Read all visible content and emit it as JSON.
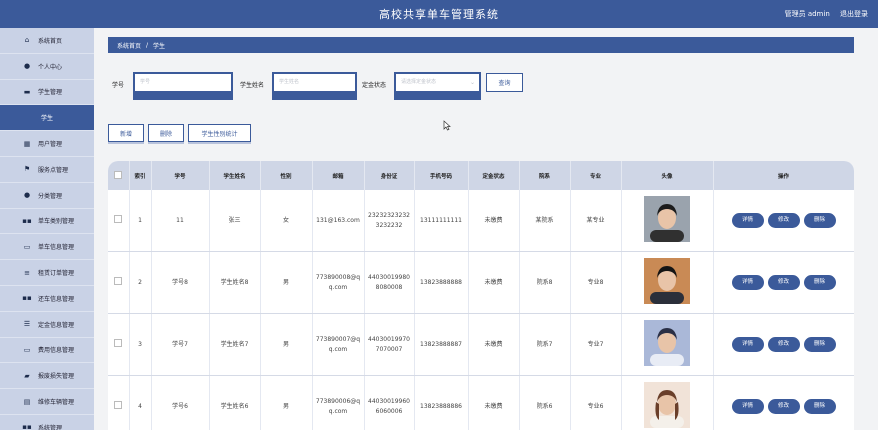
{
  "header": {
    "title": "高校共享单车管理系统",
    "user_label": "管理员 admin",
    "logout": "退出登录"
  },
  "sidebar": {
    "items": [
      {
        "label": "系统首页",
        "icon": "home-icon"
      },
      {
        "label": "个人中心",
        "icon": "user-icon"
      },
      {
        "label": "学生管理",
        "icon": "folder-icon"
      },
      {
        "label": "学生",
        "icon": "",
        "active": true
      },
      {
        "label": "用户管理",
        "icon": "grid-icon"
      },
      {
        "label": "服务点管理",
        "icon": "flag-icon"
      },
      {
        "label": "分类管理",
        "icon": "pin-icon"
      },
      {
        "label": "单车类别管理",
        "icon": "apps-icon"
      },
      {
        "label": "单车信息管理",
        "icon": "card-icon"
      },
      {
        "label": "租赁订单管理",
        "icon": "sliders-icon"
      },
      {
        "label": "还车信息管理",
        "icon": "apps-icon"
      },
      {
        "label": "定金信息管理",
        "icon": "list-icon"
      },
      {
        "label": "费用信息管理",
        "icon": "card-icon"
      },
      {
        "label": "报废损失管理",
        "icon": "car-icon"
      },
      {
        "label": "维修车辆管理",
        "icon": "document-icon"
      },
      {
        "label": "系统管理",
        "icon": "apps-icon"
      }
    ]
  },
  "breadcrumb": {
    "home": "系统首页",
    "sep": "/",
    "current": "学生"
  },
  "search": {
    "student_no_label": "学号",
    "student_no_placeholder": "学号",
    "name_label": "学生姓名",
    "name_placeholder": "学生姓名",
    "deposit_label": "定金状态",
    "deposit_placeholder": "请选择定金状态",
    "query_button": "查询"
  },
  "actions": {
    "add": "新增",
    "delete": "删除",
    "gender_stats": "学生性别统计"
  },
  "table": {
    "headers": [
      "",
      "索引",
      "学号",
      "学生姓名",
      "性别",
      "邮箱",
      "身份证",
      "手机号码",
      "定金状态",
      "院系",
      "专业",
      "头像",
      "操作"
    ],
    "op_labels": [
      "详情",
      "修改",
      "删除"
    ],
    "rows": [
      {
        "index": "1",
        "student_no": "11",
        "name": "张三",
        "gender": "女",
        "email": "131@163.com",
        "id_card": "232323232323232232",
        "phone": "13111111111",
        "deposit": "未缴费",
        "dept": "某院系",
        "major": "某专业",
        "avatar": "avatar-man-dark"
      },
      {
        "index": "2",
        "student_no": "学号8",
        "name": "学生姓名8",
        "gender": "男",
        "email": "773890008@qq.com",
        "id_card": "440300199808080008",
        "phone": "13823888888",
        "deposit": "未缴费",
        "dept": "院系8",
        "major": "专业8",
        "avatar": "avatar-man-dusk"
      },
      {
        "index": "3",
        "student_no": "学号7",
        "name": "学生姓名7",
        "gender": "男",
        "email": "773890007@qq.com",
        "id_card": "440300199707070007",
        "phone": "13823888887",
        "deposit": "未缴费",
        "dept": "院系7",
        "major": "专业7",
        "avatar": "avatar-man-blue"
      },
      {
        "index": "4",
        "student_no": "学号6",
        "name": "学生姓名6",
        "gender": "男",
        "email": "773890006@qq.com",
        "id_card": "440300199606060006",
        "phone": "13823888886",
        "deposit": "未缴费",
        "dept": "院系6",
        "major": "专业6",
        "avatar": "avatar-woman"
      }
    ]
  },
  "colors": {
    "primary": "#3b5a9a",
    "sidebar_bg": "#c9d2e6",
    "header_row": "#cfd6e6"
  }
}
